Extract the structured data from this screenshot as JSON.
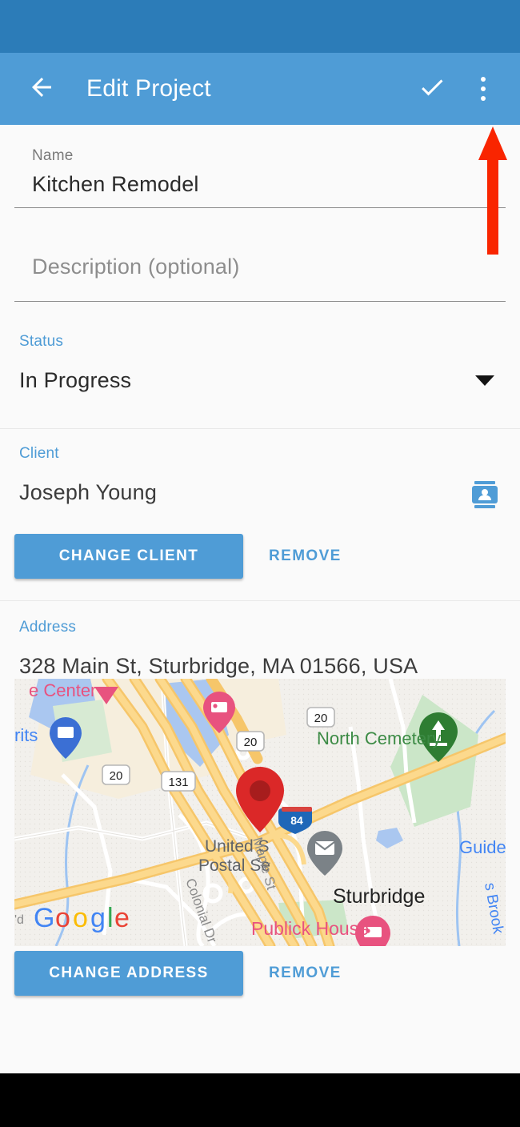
{
  "app_bar": {
    "title": "Edit Project",
    "back_icon": "arrow-back-icon",
    "confirm_icon": "check-icon",
    "overflow_icon": "more-vert-icon"
  },
  "form": {
    "name": {
      "label": "Name",
      "value": "Kitchen Remodel"
    },
    "description": {
      "placeholder": "Description (optional)",
      "value": ""
    },
    "status": {
      "label": "Status",
      "value": "In Progress",
      "dropdown_icon": "chevron-down-icon"
    }
  },
  "client_section": {
    "label": "Client",
    "value": "Joseph Young",
    "contact_icon": "contact-card-icon",
    "change_label": "CHANGE CLIENT",
    "remove_label": "REMOVE"
  },
  "address_section": {
    "label": "Address",
    "value": "328 Main St, Sturbridge, MA 01566, USA",
    "change_label": "CHANGE ADDRESS",
    "remove_label": "REMOVE"
  },
  "map": {
    "attribution": "Google",
    "marker_icon": "location-pin-icon",
    "labels": [
      {
        "text": "e Center",
        "color": "#e8527f"
      },
      {
        "text": "rits",
        "color": "#4285f4"
      },
      {
        "text": "North Cemetery",
        "color": "#3c8b45"
      },
      {
        "text": "United States",
        "color": "#5f6368"
      },
      {
        "text": "Postal Service",
        "color": "#5f6368"
      },
      {
        "text": "Sturbridge",
        "color": "#222222"
      },
      {
        "text": "Publick House",
        "color": "#e8527f"
      },
      {
        "text": "Guide t",
        "color": "#4285f4"
      },
      {
        "text": "Colonial Dr",
        "color": "#8a8a8a"
      },
      {
        "text": "Maple St",
        "color": "#8a8a8a"
      },
      {
        "text": "s Brook",
        "color": "#4285f4"
      },
      {
        "text": "'d",
        "color": "#8a8a8a"
      }
    ],
    "route_shields": [
      "20",
      "20",
      "131",
      "20",
      "84"
    ],
    "google_logo_letters": [
      {
        "char": "G",
        "color": "#4285f4"
      },
      {
        "char": "o",
        "color": "#ea4335"
      },
      {
        "char": "o",
        "color": "#fbbc05"
      },
      {
        "char": "g",
        "color": "#4285f4"
      },
      {
        "char": "l",
        "color": "#34a853"
      },
      {
        "char": "e",
        "color": "#ea4335"
      }
    ]
  },
  "annotation": {
    "arrow_color": "#f92500",
    "points_to": "more-vert-icon"
  },
  "colors": {
    "status_bar": "#2c7cb8",
    "app_bar": "#4f9cd6",
    "accent": "#4f9cd6",
    "background": "#fafafa",
    "nav_bar": "#000000"
  }
}
